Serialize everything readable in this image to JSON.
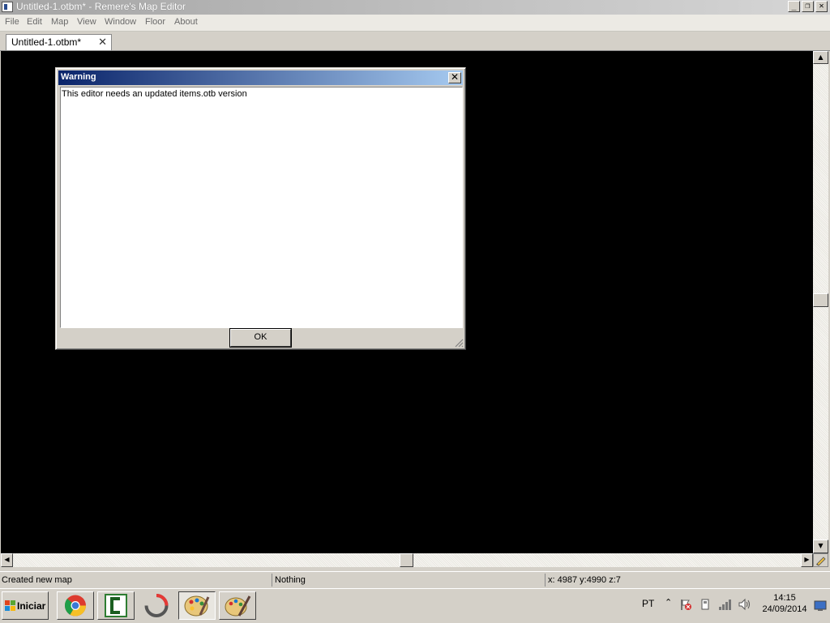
{
  "window": {
    "title": "Untitled-1.otbm* - Remere's Map Editor",
    "controls": {
      "minimize": "_",
      "restore": "❐",
      "close": "✕"
    }
  },
  "menu": {
    "items": [
      "File",
      "Edit",
      "Map",
      "View",
      "Window",
      "Floor",
      "About"
    ]
  },
  "tabs": [
    {
      "label": "Untitled-1.otbm*",
      "close": "✕"
    }
  ],
  "dialog": {
    "title": "Warning",
    "close": "✕",
    "message": "This editor needs an updated items.otb version",
    "ok_label": "OK"
  },
  "statusbar": {
    "message": "Created new map",
    "selection": "Nothing",
    "coords": "x: 4987 y:4990 z:7"
  },
  "taskbar": {
    "start_label": "Iniciar",
    "apps": [
      {
        "icon": "chrome-icon"
      },
      {
        "icon": "camtasia-icon"
      },
      {
        "icon": "sync-icon"
      },
      {
        "icon": "remeres-map-editor-icon",
        "active": true
      },
      {
        "icon": "paint-icon"
      }
    ],
    "tray": {
      "language": "PT",
      "time": "14:15",
      "date": "24/09/2014"
    }
  },
  "colors": {
    "canvas": "#000000",
    "dialog_title_start": "#0a246a",
    "dialog_title_end": "#a6caf0",
    "chrome": "#d4d0c8"
  }
}
